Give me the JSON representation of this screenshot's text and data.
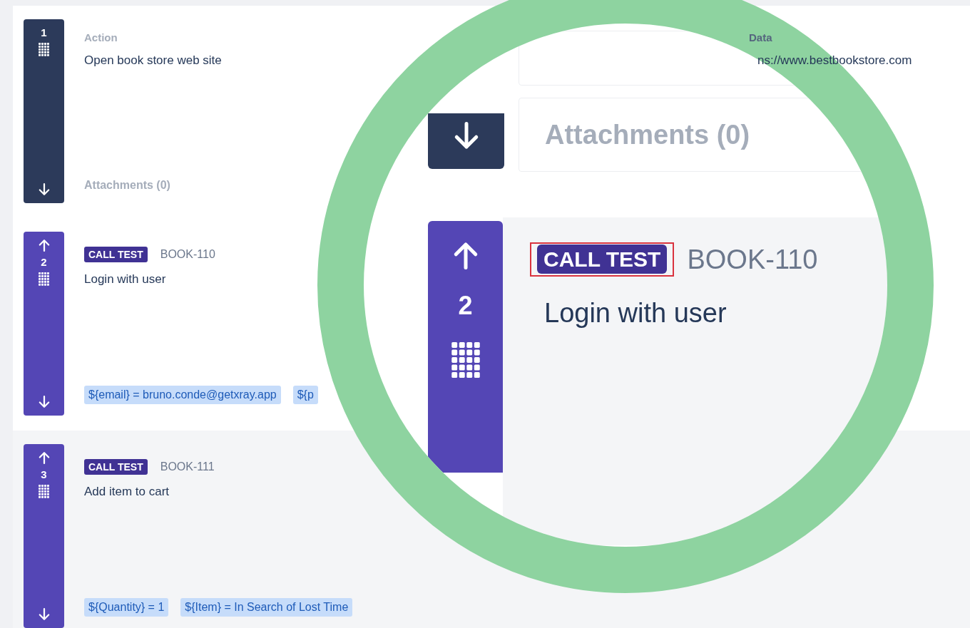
{
  "steps": [
    {
      "number": "1",
      "kind": "plain",
      "move_up": false,
      "selected": false,
      "action_label": "Action",
      "action": "Open book store web site",
      "attachments": "Attachments (0)",
      "data_label": "Data",
      "data": "ns://www.bestbookstore.com"
    },
    {
      "number": "2",
      "kind": "call_test",
      "move_up": true,
      "selected": false,
      "badge": "CALL TEST",
      "test_key": "BOOK-110",
      "action": "Login with user",
      "parameters": [
        "${email} = bruno.conde@getxray.app",
        "${p"
      ]
    },
    {
      "number": "3",
      "kind": "call_test",
      "move_up": true,
      "selected": true,
      "badge": "CALL TEST",
      "test_key": "BOOK-111",
      "action": "Add item to cart",
      "parameters": [
        "${Quantity} = 1",
        "${Item} = In Search of Lost Time"
      ]
    }
  ],
  "magnifier": {
    "attachments": "Attachments (0)",
    "number": "2",
    "badge": "CALL TEST",
    "badge_outlined": true,
    "test_key": "BOOK-110",
    "action": "Login with user"
  }
}
